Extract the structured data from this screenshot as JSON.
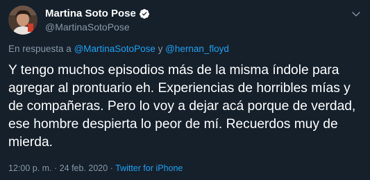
{
  "author": {
    "display_name": "Martina Soto Pose",
    "handle": "@MartinaSotoPose",
    "verified": true
  },
  "reply": {
    "prefix": "En respuesta a",
    "mention_1": "@MartinaSotoPose",
    "joiner": "y",
    "mention_2": "@hernan_floyd"
  },
  "tweet": {
    "text": "Y tengo muchos episodios más de la misma índole para agregar al prontuario eh. Experiencias de horribles mías y de compañeras. Pero lo voy a dejar acá porque de verdad, ese hombre despierta lo peor de mí. Recuerdos muy de mierda."
  },
  "meta": {
    "time": "12:00 p. m.",
    "separator": "·",
    "date": "24 feb. 2020",
    "source": "Twitter for iPhone"
  },
  "icons": {
    "verified": "verified-badge-icon",
    "more": "chevron-down-icon"
  },
  "colors": {
    "background": "#15202b",
    "text": "#ffffff",
    "secondary": "#8899a6",
    "accent": "#1da1f2"
  }
}
